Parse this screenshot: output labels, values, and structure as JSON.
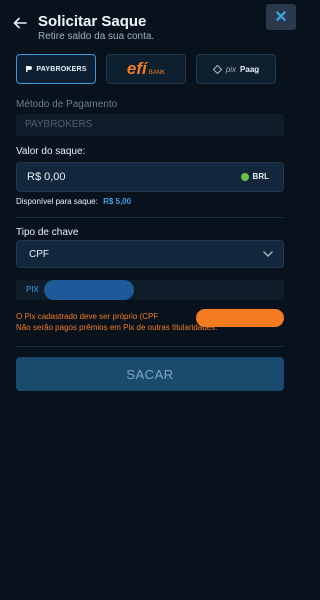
{
  "header": {
    "title": "Solicitar Saque",
    "subtitle": "Retire saldo da sua conta.",
    "close_label": "✕"
  },
  "providers": [
    {
      "label": "PAYBROKERS"
    },
    {
      "label_main": "efí",
      "label_sub": "BANK"
    },
    {
      "label_pix": "pix",
      "label_brand": "Paag"
    }
  ],
  "payment_method": {
    "label": "Método de Pagamento",
    "value": "PAYBROKERS"
  },
  "amount": {
    "label": "Valor do saque:",
    "value": "R$ 0,00",
    "currency": "BRL",
    "available_label": "Disponível para saque:",
    "available_value": "R$ 5,00"
  },
  "key_type": {
    "label": "Tipo de chave",
    "value": "CPF"
  },
  "pix_field": {
    "label": "PIX"
  },
  "warning": {
    "line1": "O Pix cadastrado deve ser próprio (CPF",
    "line2": "Não serão pagos prêmios em Pix de outras titularidades."
  },
  "submit_label": "SACAR",
  "colors": {
    "accent_blue": "#3fa3e8",
    "warning_orange": "#f47b20",
    "background": "#08121d"
  }
}
